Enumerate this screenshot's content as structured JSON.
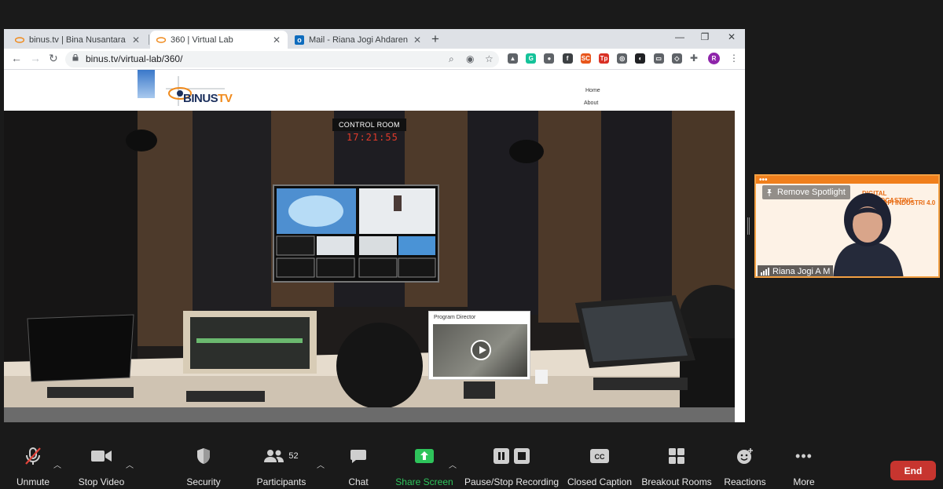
{
  "browser": {
    "tabs": [
      {
        "title": "binus.tv | Bina Nusantara Televisi",
        "active": false
      },
      {
        "title": "360 | Virtual Lab",
        "active": true
      },
      {
        "title": "Mail - Riana Jogi Ahdareni M - O",
        "active": false
      }
    ],
    "url": "binus.tv/virtual-lab/360/",
    "extensions": [
      {
        "name": "cube-extension-icon",
        "color": "#5f6368",
        "glyph": "▲"
      },
      {
        "name": "grammarly-extension-icon",
        "color": "#15c39a",
        "glyph": "G"
      },
      {
        "name": "circle-extension-icon",
        "color": "#5f6368",
        "glyph": "●"
      },
      {
        "name": "facebook-extension-icon",
        "color": "#3c4043",
        "glyph": "f"
      },
      {
        "name": "sc-extension-icon",
        "color": "#e8561c",
        "glyph": "SC"
      },
      {
        "name": "tp-extension-icon",
        "color": "#d93025",
        "glyph": "Tp"
      },
      {
        "name": "compass-extension-icon",
        "color": "#5f6368",
        "glyph": "◎"
      },
      {
        "name": "mask-extension-icon",
        "color": "#202124",
        "glyph": "◐"
      },
      {
        "name": "chat-extension-icon",
        "color": "#5f6368",
        "glyph": "▭"
      },
      {
        "name": "shield-extension-icon",
        "color": "#5f6368",
        "glyph": "◇"
      }
    ],
    "profile_initial": "R",
    "profile_color": "#8e24aa"
  },
  "site": {
    "logo_text_main": "BINUS",
    "logo_text_tv": "TV",
    "nav": [
      "Home",
      "About"
    ]
  },
  "panorama": {
    "control_room_label": "CONTROL ROOM",
    "clock": "17:21:55",
    "hotspot_label": "Program Director"
  },
  "video_tile": {
    "remove_spotlight_label": "Remove Spotlight",
    "participant_name": "Riana Jogi A M",
    "slide_title_line1": "DIGITAL BROADCASTING",
    "slide_title_line2": "ADAPI INDUSTRI 4.0",
    "border_color": "#f3a043"
  },
  "controls": {
    "unmute": "Unmute",
    "stop_video": "Stop Video",
    "security": "Security",
    "participants": "Participants",
    "participants_count": "52",
    "chat": "Chat",
    "share_screen": "Share Screen",
    "recording": "Pause/Stop Recording",
    "closed_caption": "Closed Caption",
    "breakout_rooms": "Breakout Rooms",
    "reactions": "Reactions",
    "more": "More",
    "end": "End",
    "share_color": "#2ec45b",
    "end_color": "#c7352f"
  }
}
